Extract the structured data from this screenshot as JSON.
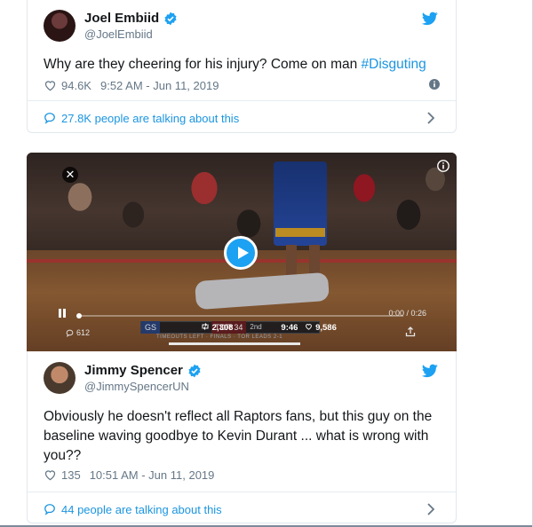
{
  "tweet1": {
    "display_name": "Joel Embiid",
    "handle": "@JoelEmbiid",
    "text_before": "Why are they cheering for his injury? Come on man ",
    "hashtag": "#Disguting",
    "likes": "94.6K",
    "timestamp": "9:52 AM - Jun 11, 2019",
    "talking": "27.8K people are talking about this"
  },
  "video": {
    "close_glyph": "✕",
    "time": "0:00 / 0:26",
    "views": "612",
    "score_gs_label": "GS",
    "score_tor_label": "TOR 34",
    "quarter": "2nd",
    "retweets_overlay": "2,308",
    "clock_overlay": "9:46",
    "likes_overlay": "9,586",
    "bug_subtitle": "TIMEOUTS LEFT · FINALS · TOR LEADS 2-1"
  },
  "tweet2": {
    "display_name": "Jimmy Spencer",
    "handle": "@JimmySpencerUN",
    "text": "Obviously he doesn't reflect all Raptors fans, but this guy on the baseline waving goodbye to Kevin Durant ... what is wrong with you??",
    "likes": "135",
    "timestamp": "10:51 AM - Jun 11, 2019",
    "talking": "44 people are talking about this"
  },
  "colors": {
    "accent": "#1da1f2",
    "link": "#1b95e0",
    "secondary_text": "#657786",
    "border": "#e1e8ed"
  },
  "icons": [
    "twitter-bird-icon",
    "verified-badge-icon",
    "heart-icon",
    "info-icon",
    "chat-bubble-icon",
    "chevron-right-icon",
    "play-icon",
    "pause-icon",
    "close-icon",
    "share-icon",
    "retweet-icon"
  ]
}
